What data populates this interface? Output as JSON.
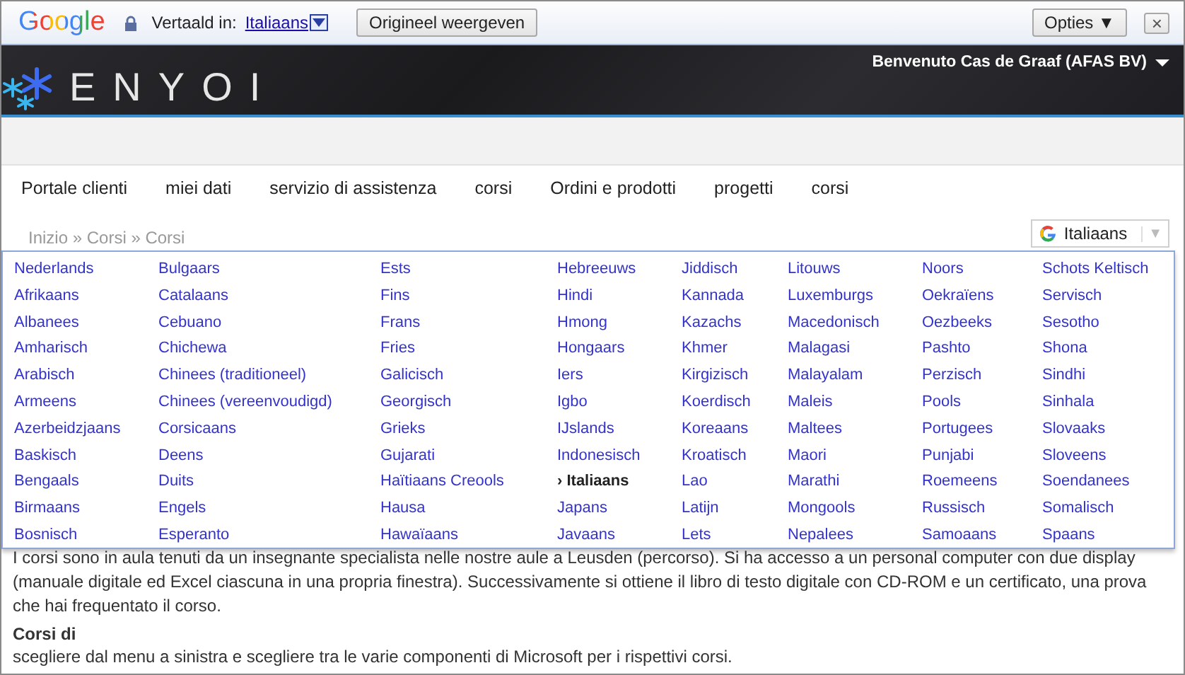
{
  "translate_bar": {
    "logo": "Google",
    "label": "Vertaald in:",
    "language": "Italiaans",
    "show_original": "Origineel weergeven",
    "options": "Opties ▼",
    "close": "×"
  },
  "header": {
    "welcome": "Benvenuto Cas de Graaf (AFAS BV)",
    "logo": "ENYOI"
  },
  "nav": [
    "Portale clienti",
    "miei dati",
    "servizio di assistenza",
    "corsi",
    "Ordini e prodotti",
    "progetti",
    "corsi"
  ],
  "breadcrumb": "Inizio » Corsi » Corsi",
  "language_widget": {
    "language": "Italiaans",
    "caret": "▼"
  },
  "language_menu": [
    [
      {
        "label": "Nederlands",
        "selected": false
      },
      {
        "label": "Afrikaans",
        "selected": false
      },
      {
        "label": "Albanees",
        "selected": false
      },
      {
        "label": "Amharisch",
        "selected": false
      },
      {
        "label": "Arabisch",
        "selected": false
      },
      {
        "label": "Armeens",
        "selected": false
      },
      {
        "label": "Azerbeidzjaans",
        "selected": false
      },
      {
        "label": "Baskisch",
        "selected": false
      },
      {
        "label": "Bengaals",
        "selected": false
      },
      {
        "label": "Birmaans",
        "selected": false
      },
      {
        "label": "Bosnisch",
        "selected": false
      }
    ],
    [
      {
        "label": "Bulgaars",
        "selected": false
      },
      {
        "label": "Catalaans",
        "selected": false
      },
      {
        "label": "Cebuano",
        "selected": false
      },
      {
        "label": "Chichewa",
        "selected": false
      },
      {
        "label": "Chinees (traditioneel)",
        "selected": false
      },
      {
        "label": "Chinees (vereenvoudigd)",
        "selected": false
      },
      {
        "label": "Corsicaans",
        "selected": false
      },
      {
        "label": "Deens",
        "selected": false
      },
      {
        "label": "Duits",
        "selected": false
      },
      {
        "label": "Engels",
        "selected": false
      },
      {
        "label": "Esperanto",
        "selected": false
      }
    ],
    [
      {
        "label": "Ests",
        "selected": false
      },
      {
        "label": "Fins",
        "selected": false
      },
      {
        "label": "Frans",
        "selected": false
      },
      {
        "label": "Fries",
        "selected": false
      },
      {
        "label": "Galicisch",
        "selected": false
      },
      {
        "label": "Georgisch",
        "selected": false
      },
      {
        "label": "Grieks",
        "selected": false
      },
      {
        "label": "Gujarati",
        "selected": false
      },
      {
        "label": "Haïtiaans Creools",
        "selected": false
      },
      {
        "label": "Hausa",
        "selected": false
      },
      {
        "label": "Hawaïaans",
        "selected": false
      }
    ],
    [
      {
        "label": "Hebreeuws",
        "selected": false
      },
      {
        "label": "Hindi",
        "selected": false
      },
      {
        "label": "Hmong",
        "selected": false
      },
      {
        "label": "Hongaars",
        "selected": false
      },
      {
        "label": "Iers",
        "selected": false
      },
      {
        "label": "Igbo",
        "selected": false
      },
      {
        "label": "IJslands",
        "selected": false
      },
      {
        "label": "Indonesisch",
        "selected": false
      },
      {
        "label": "› Italiaans",
        "selected": true
      },
      {
        "label": "Japans",
        "selected": false
      },
      {
        "label": "Javaans",
        "selected": false
      }
    ],
    [
      {
        "label": "Jiddisch",
        "selected": false
      },
      {
        "label": "Kannada",
        "selected": false
      },
      {
        "label": "Kazachs",
        "selected": false
      },
      {
        "label": "Khmer",
        "selected": false
      },
      {
        "label": "Kirgizisch",
        "selected": false
      },
      {
        "label": "Koerdisch",
        "selected": false
      },
      {
        "label": "Koreaans",
        "selected": false
      },
      {
        "label": "Kroatisch",
        "selected": false
      },
      {
        "label": "Lao",
        "selected": false
      },
      {
        "label": "Latijn",
        "selected": false
      },
      {
        "label": "Lets",
        "selected": false
      }
    ],
    [
      {
        "label": "Litouws",
        "selected": false
      },
      {
        "label": "Luxemburgs",
        "selected": false
      },
      {
        "label": "Macedonisch",
        "selected": false
      },
      {
        "label": "Malagasi",
        "selected": false
      },
      {
        "label": "Malayalam",
        "selected": false
      },
      {
        "label": "Maleis",
        "selected": false
      },
      {
        "label": "Maltees",
        "selected": false
      },
      {
        "label": "Maori",
        "selected": false
      },
      {
        "label": "Marathi",
        "selected": false
      },
      {
        "label": "Mongools",
        "selected": false
      },
      {
        "label": "Nepalees",
        "selected": false
      }
    ],
    [
      {
        "label": "Noors",
        "selected": false
      },
      {
        "label": "Oekraïens",
        "selected": false
      },
      {
        "label": "Oezbeeks",
        "selected": false
      },
      {
        "label": "Pashto",
        "selected": false
      },
      {
        "label": "Perzisch",
        "selected": false
      },
      {
        "label": "Pools",
        "selected": false
      },
      {
        "label": "Portugees",
        "selected": false
      },
      {
        "label": "Punjabi",
        "selected": false
      },
      {
        "label": "Roemeens",
        "selected": false
      },
      {
        "label": "Russisch",
        "selected": false
      },
      {
        "label": "Samoaans",
        "selected": false
      }
    ],
    [
      {
        "label": "Schots Keltisch",
        "selected": false
      },
      {
        "label": "Servisch",
        "selected": false
      },
      {
        "label": "Sesotho",
        "selected": false
      },
      {
        "label": "Shona",
        "selected": false
      },
      {
        "label": "Sindhi",
        "selected": false
      },
      {
        "label": "Sinhala",
        "selected": false
      },
      {
        "label": "Slovaaks",
        "selected": false
      },
      {
        "label": "Sloveens",
        "selected": false
      },
      {
        "label": "Soendanees",
        "selected": false
      },
      {
        "label": "Somalisch",
        "selected": false
      },
      {
        "label": "Spaans",
        "selected": false
      }
    ]
  ],
  "content": {
    "intro": "I corsi sono in aula tenuti da un insegnante specialista nelle nostre aule a Leusden (percorso). Si ha accesso a un personal computer con due display (manuale digitale ed Excel ciascuna in una propria finestra). Successivamente si ottiene il libro di testo digitale con CD-ROM e un certificato, una prova che hai frequentato il corso.",
    "heading": "Corsi di",
    "text": "scegliere dal menu a sinistra e scegliere tra le varie componenti di Microsoft per i rispettivi corsi."
  }
}
